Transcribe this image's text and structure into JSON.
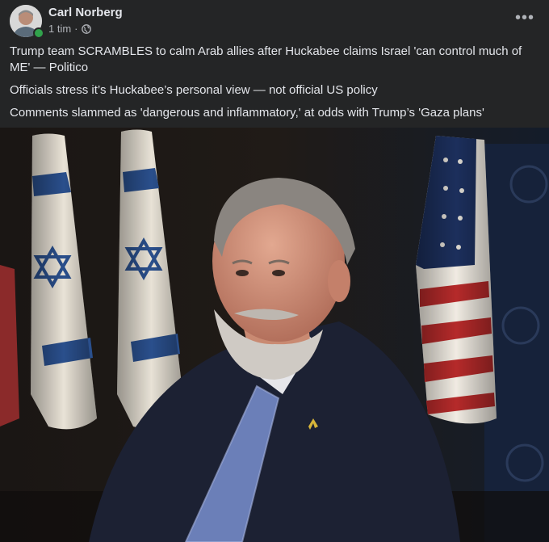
{
  "post": {
    "author": "Carl Norberg",
    "timestamp": "1 tim",
    "separator": "·",
    "privacy_icon": "globe-icon",
    "more_label": "•••",
    "lines": [
      "Trump team SCRAMBLES to calm Arab allies after Huckabee claims Israel 'can control much of ME' — Politico",
      "Officials stress it’s Huckabee’s personal view — not official US policy",
      "Comments slammed as 'dangerous and inflammatory,' at odds with Trump’s 'Gaza plans'"
    ]
  },
  "colors": {
    "background": "#242526",
    "text_primary": "#e4e6eb",
    "text_secondary": "#b0b3b8",
    "online": "#31a24c"
  }
}
